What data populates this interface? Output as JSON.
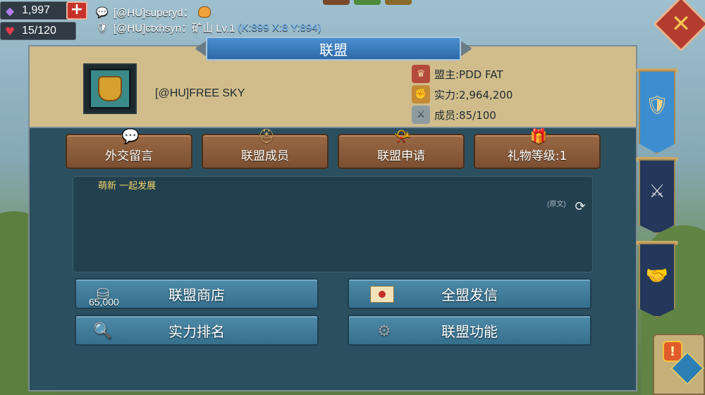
{
  "resources": {
    "gems": "1,997",
    "gems_icon": "gem-icon",
    "stamina": "15/120",
    "stamina_icon": "heart-icon",
    "add_icon": "plus-icon"
  },
  "chat": [
    {
      "text": "[@HU]superyd：",
      "icon": "chat-bubble-icon",
      "coords": ""
    },
    {
      "text": "[@HU]ctxhsyn：矿山 Lv.1",
      "icon": "alliance-badge-icon",
      "coords": "(K:899 X:8 Y:894)"
    }
  ],
  "window": {
    "title": "联盟",
    "close_icon": "close-icon"
  },
  "alliance": {
    "name": "[@HU]FREE SKY",
    "leader": "盟主:PDD FAT",
    "power": "实力:2,964,200",
    "members": "成员:85/100"
  },
  "main_buttons": [
    {
      "label": "外交留言",
      "icon": "chat-icon"
    },
    {
      "label": "联盟成员",
      "icon": "helmet-icon"
    },
    {
      "label": "联盟申请",
      "icon": "horn-icon"
    },
    {
      "label": "礼物等级:1",
      "icon": "gift-icon"
    }
  ],
  "announcement": {
    "text": "萌新 一起发展",
    "original_label": "(原文)"
  },
  "actions": [
    {
      "label": "联盟商店",
      "icon": "coin-icon",
      "amount": "65,000"
    },
    {
      "label": "全盟发信",
      "icon": "letter-icon"
    },
    {
      "label": "实力排名",
      "icon": "magnifier-icon"
    },
    {
      "label": "联盟功能",
      "icon": "gear-icon"
    }
  ],
  "side_tabs": [
    {
      "name": "alliance",
      "icon": "winged-shield-icon",
      "active": true
    },
    {
      "name": "war",
      "icon": "crossed-swords-icon",
      "active": false
    },
    {
      "name": "help",
      "icon": "handshake-icon",
      "active": false
    }
  ],
  "colors": {
    "panel": "#2c4f5f",
    "header_band": "#d1bd8c",
    "brown_button": "#8a5c3b",
    "blue_button": "#4580a0",
    "title_banner": "#3b7cbd",
    "coord_text": "#7fc0ff",
    "announcement_text": "#f2d46a"
  }
}
